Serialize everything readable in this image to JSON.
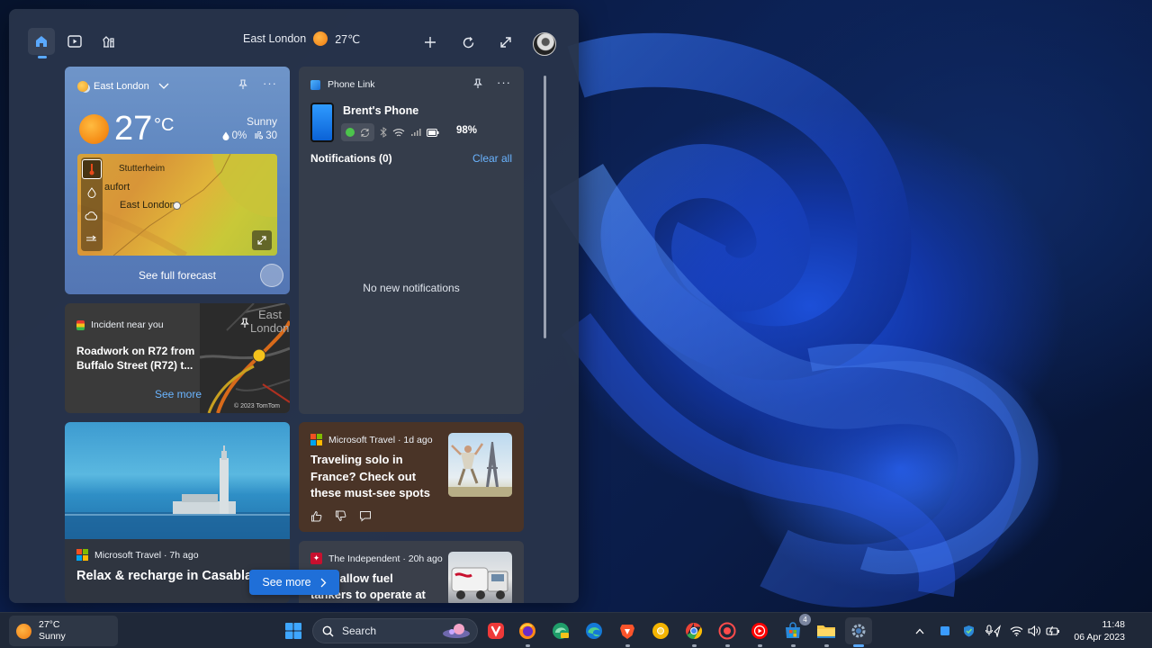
{
  "widgets": {
    "topbar": {
      "location": "East London",
      "temp": "27℃"
    },
    "weather": {
      "location": "East London",
      "temp": "27",
      "unit": "°C",
      "condition": "Sunny",
      "precip": "0%",
      "wind": "30",
      "map_labels": [
        "Stutterheim",
        "aufort",
        "East London"
      ],
      "forecast_link": "See full forecast"
    },
    "phone_link": {
      "title": "Phone Link",
      "device_name": "Brent's Phone",
      "battery": "98%",
      "notifications_title": "Notifications (0)",
      "clear_all": "Clear all",
      "empty_message": "No new notifications"
    },
    "incident": {
      "header": "Incident near you",
      "title": "Roadwork on R72 from Buffalo Street (R72) t...",
      "see_more": "See more",
      "map_text_1": "East",
      "map_text_2": "London",
      "map_credit": "© 2023 TomTom"
    },
    "casablanca": {
      "source": "Microsoft Travel · 7h ago",
      "title": "Relax & recharge in Casablanca"
    },
    "travel_solo": {
      "source": "Microsoft Travel · 1d ago",
      "title": "Traveling solo in France? Check out these must-see spots"
    },
    "independent": {
      "source": "The Independent · 20h ago",
      "title": "… to allow fuel tankers to operate at"
    },
    "see_more_button": "See more"
  },
  "taskbar": {
    "weather_temp": "27°C",
    "weather_condition": "Sunny",
    "search_label": "Search",
    "store_badge": "4",
    "time": "11:48",
    "date": "06 Apr 2023"
  },
  "colors": {
    "accent": "#1f6fd8",
    "link": "#6ab4ff",
    "panel": "#28344a",
    "weather_card": "#5a82bd"
  }
}
